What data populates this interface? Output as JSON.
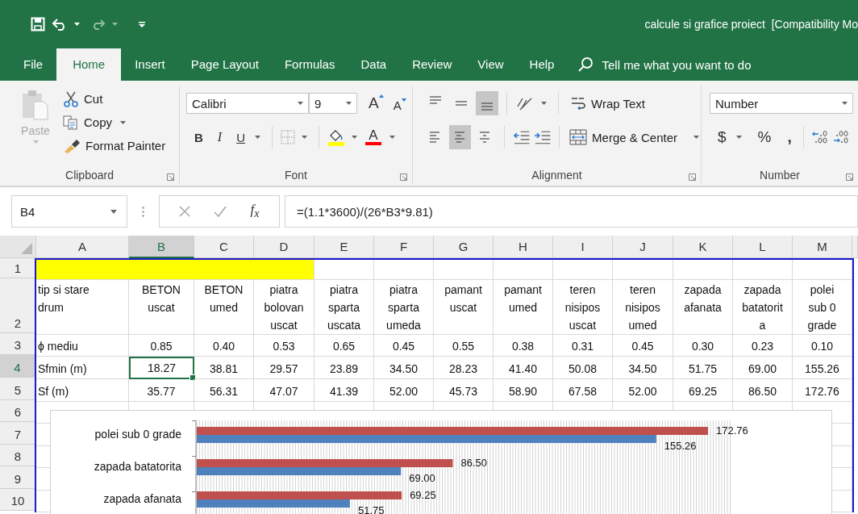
{
  "window": {
    "title": "calcule si grafice proiect  [Compatibility Mo"
  },
  "ribbon_tabs": [
    {
      "label": "File",
      "selected": false
    },
    {
      "label": "Home",
      "selected": true
    },
    {
      "label": "Insert",
      "selected": false
    },
    {
      "label": "Page Layout",
      "selected": false
    },
    {
      "label": "Formulas",
      "selected": false
    },
    {
      "label": "Data",
      "selected": false
    },
    {
      "label": "Review",
      "selected": false
    },
    {
      "label": "View",
      "selected": false
    },
    {
      "label": "Help",
      "selected": false
    }
  ],
  "tell_me": {
    "placeholder": "Tell me what you want to do"
  },
  "clipboard": {
    "paste": "Paste",
    "cut": "Cut",
    "copy": "Copy",
    "format_painter": "Format Painter",
    "label": "Clipboard"
  },
  "font": {
    "name": "Calibri",
    "size": "9",
    "grow": "A",
    "shrink": "A",
    "bold": "B",
    "italic": "I",
    "underline": "U",
    "font_color": "A",
    "label": "Font"
  },
  "alignment": {
    "vertical": [
      {
        "kind": "top",
        "selected": false
      },
      {
        "kind": "middle",
        "selected": false
      },
      {
        "kind": "bottom",
        "selected": true
      }
    ],
    "horizontal": [
      {
        "kind": "left",
        "selected": false
      },
      {
        "kind": "center",
        "selected": true
      },
      {
        "kind": "right",
        "selected": false
      }
    ],
    "wrap_text": "Wrap Text",
    "merge": "Merge & Center",
    "label": "Alignment"
  },
  "number": {
    "format": "Number",
    "currency": "$",
    "percent": "%",
    "comma": ",",
    "label": "Number"
  },
  "formula_bar": {
    "name_box": "B4",
    "function_label": "f$_{x}$",
    "formula": "=(1.1*3600)/(26*B3*9.81)"
  },
  "sheet": {
    "columns": [
      {
        "label": "A",
        "selected": false
      },
      {
        "label": "B",
        "selected": true
      },
      {
        "label": "C",
        "selected": false
      },
      {
        "label": "D",
        "selected": false
      },
      {
        "label": "E",
        "selected": false
      },
      {
        "label": "F",
        "selected": false
      },
      {
        "label": "G",
        "selected": false
      },
      {
        "label": "H",
        "selected": false
      },
      {
        "label": "I",
        "selected": false
      },
      {
        "label": "J",
        "selected": false
      },
      {
        "label": "K",
        "selected": false
      },
      {
        "label": "L",
        "selected": false
      },
      {
        "label": "M",
        "selected": false
      }
    ],
    "rows": [
      {
        "number": "1",
        "selected": false,
        "color": "#ffff00"
      },
      {
        "number": "2",
        "selected": false,
        "cells": [
          "tip si stare\ndrum",
          "BETON\nuscat",
          "BETON\numed",
          "piatra\nbolovan\nuscat",
          "piatra\nsparta\nuscata",
          "piatra\nsparta\numeda",
          "pamant\nuscat",
          "pamant\numed",
          "teren\nnisipos\nuscat",
          "teren\nnisipos\numed",
          "zapada\nafanata",
          "zapada\nbatatorit\na",
          "polei\nsub 0\ngrade"
        ]
      },
      {
        "number": "3",
        "selected": false,
        "cells": [
          "ϕ mediu",
          "0.85",
          "0.40",
          "0.53",
          "0.65",
          "0.45",
          "0.55",
          "0.38",
          "0.31",
          "0.45",
          "0.30",
          "0.23",
          "0.10"
        ]
      },
      {
        "number": "4",
        "selected": true,
        "cells": [
          "Sfmin (m)",
          "18.27",
          "38.81",
          "29.57",
          "23.89",
          "34.50",
          "28.23",
          "41.40",
          "50.08",
          "34.50",
          "51.75",
          "69.00",
          "155.26"
        ]
      },
      {
        "number": "5",
        "selected": false,
        "cells": [
          "Sf (m)",
          "35.77",
          "56.31",
          "47.07",
          "41.39",
          "52.00",
          "45.73",
          "58.90",
          "67.58",
          "52.00",
          "69.25",
          "86.50",
          "172.76"
        ]
      },
      {
        "number": "6",
        "selected": false
      },
      {
        "number": "7",
        "selected": false
      },
      {
        "number": "8",
        "selected": false
      },
      {
        "number": "9",
        "selected": false
      },
      {
        "number": "10",
        "selected": false
      }
    ]
  },
  "chart": {
    "chart_data": {
      "type": "bar",
      "orientation": "horizontal",
      "categories": [
        "polei sub 0 grade",
        "zapada batatorita",
        "zapada afanata"
      ],
      "series": [
        {
          "color": "#c0504d",
          "values": [
            172.76,
            86.5,
            69.25
          ],
          "value_labels": [
            "172.76",
            "86.50",
            "69.25"
          ]
        },
        {
          "color": "#4f81bd",
          "values": [
            155.26,
            69.0,
            51.75
          ],
          "value_labels": [
            "155.26",
            "69.00",
            "51.75"
          ]
        }
      ]
    }
  }
}
